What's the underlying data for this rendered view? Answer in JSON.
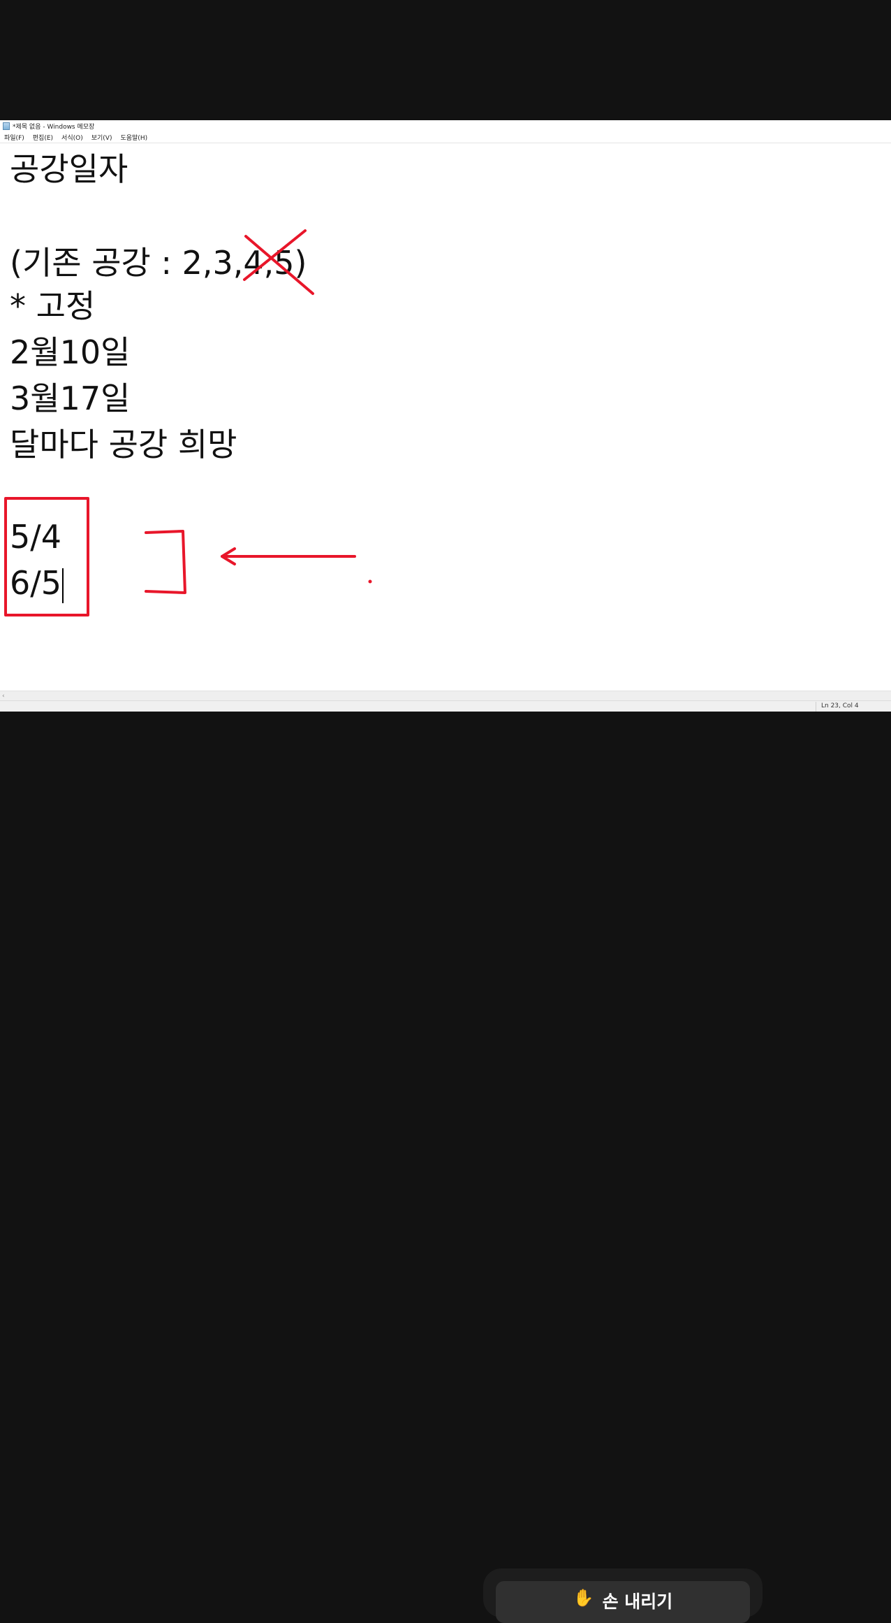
{
  "window": {
    "title": "*제목 없음 - Windows 메모장"
  },
  "menu": {
    "items": [
      "파일(F)",
      "편집(E)",
      "서식(O)",
      "보기(V)",
      "도움말(H)"
    ]
  },
  "document": {
    "lines": [
      "공강일자",
      "",
      "(기존 공강 : 2,3,4,5)",
      "* 고정",
      "2월10일",
      "3월17일",
      "달마다 공강 희망",
      "",
      "5/4",
      "6/5"
    ]
  },
  "status": {
    "position": "Ln 23, Col 4"
  },
  "meeting": {
    "lower_hand_label": "손 내리기",
    "hand_icon": "raised-hand-icon"
  },
  "colors": {
    "annotation": "#e8162a",
    "background": "#121212"
  }
}
